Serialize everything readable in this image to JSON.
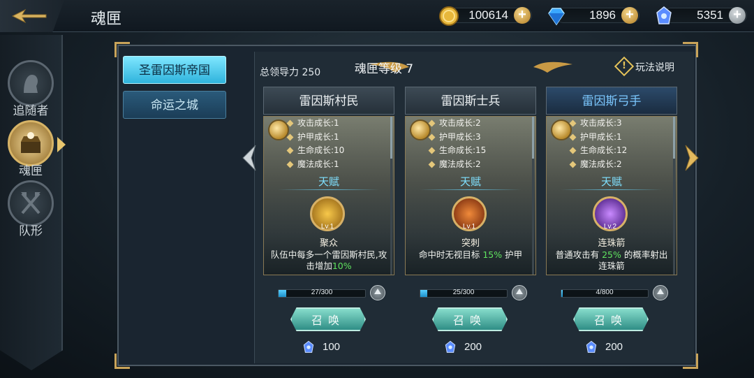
{
  "header": {
    "title": "魂匣",
    "resources": [
      {
        "name": "gold",
        "value": "100614",
        "icon": "gold-coin-icon"
      },
      {
        "name": "diamond",
        "value": "1896",
        "icon": "blue-diamond-icon"
      },
      {
        "name": "soul_crystal",
        "value": "5351",
        "icon": "soul-crystal-icon"
      }
    ]
  },
  "sidebar": {
    "items": [
      {
        "label": "追随者",
        "icon": "follower-head-icon",
        "active": false
      },
      {
        "label": "魂匣",
        "icon": "soul-box-icon",
        "active": true
      },
      {
        "label": "队形",
        "icon": "formation-axes-icon",
        "active": false
      }
    ]
  },
  "tabs": [
    {
      "label": "圣雷因斯帝国",
      "active": true
    },
    {
      "label": "命运之城",
      "active": false
    }
  ],
  "panel": {
    "leadership": "总领导力 250",
    "level_title": "魂匣等级 7",
    "help_label": "玩法说明",
    "talent_label": "天赋",
    "summon_label": "召唤"
  },
  "cards": [
    {
      "name": "雷因斯村民",
      "stats": [
        "攻击成长:1",
        "护甲成长:1",
        "生命成长:10",
        "魔法成长:1"
      ],
      "skill_level": "Lv.1",
      "skill_name": "聚众",
      "skill_desc_a": "队伍中每多一个雷因斯村民,攻击增加",
      "skill_desc_hl": "10%",
      "skill_desc_b": "",
      "progress_text": "27/300",
      "progress": 0.09,
      "cost": "100",
      "color": "#f7c84a"
    },
    {
      "name": "雷因斯士兵",
      "stats": [
        "攻击成长:2",
        "护甲成长:3",
        "生命成长:15",
        "魔法成长:2"
      ],
      "skill_level": "Lv.1",
      "skill_name": "突刺",
      "skill_desc_a": "命中时无视目标",
      "skill_desc_hl": "15%",
      "skill_desc_b": "护甲",
      "progress_text": "25/300",
      "progress": 0.083,
      "cost": "200",
      "color": "#e0601e"
    },
    {
      "name": "雷因斯弓手",
      "stats": [
        "攻击成长:3",
        "护甲成长:1",
        "生命成长:12",
        "魔法成长:2"
      ],
      "skill_level": "Lv.2",
      "skill_name": "连珠箭",
      "skill_desc_a": "普通攻击有",
      "skill_desc_hl": "25%",
      "skill_desc_b": "的概率射出连珠箭",
      "progress_text": "4/800",
      "progress": 0.005,
      "cost": "200",
      "color": "#9a4ae8"
    }
  ]
}
